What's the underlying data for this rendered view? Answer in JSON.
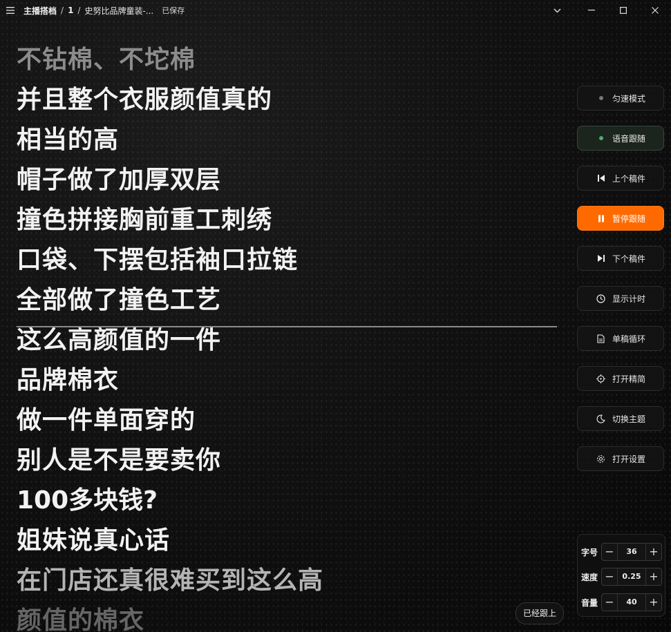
{
  "titlebar": {
    "menu_icon": "hamburger-icon",
    "app_name": "主播搭档",
    "sep1": "/",
    "index": "1",
    "sep2": "/",
    "script_title": "史努比品牌童装-...",
    "status": "已保存",
    "dropdown_icon": "chevron-down-icon",
    "controls": [
      "minimize-icon",
      "maximize-icon",
      "close-icon"
    ]
  },
  "script": {
    "lines": [
      "不钻棉、不坨棉",
      "并且整个衣服颜值真的",
      "相当的高",
      "帽子做了加厚双层",
      "撞色拼接胸前重工刺绣",
      "口袋、下摆包括袖口拉链",
      "全部做了撞色工艺",
      "这么高颜值的一件",
      "品牌棉衣",
      "做一件单面穿的",
      "别人是不是要卖你",
      "100多块钱?",
      "姐妹说真心话",
      "在门店还真很难买到这么高",
      "颜值的棉衣"
    ]
  },
  "caught_up_label": "已经跟上",
  "panel": {
    "buttons": [
      {
        "label": "匀速模式",
        "icon": "dot-icon"
      },
      {
        "label": "语音跟随",
        "icon": "dot-icon"
      },
      {
        "label": "上个稿件",
        "icon": "skip-previous-icon"
      },
      {
        "label": "暂停跟随",
        "icon": "pause-icon"
      },
      {
        "label": "下个稿件",
        "icon": "skip-next-icon"
      },
      {
        "label": "显示计时",
        "icon": "clock-icon"
      },
      {
        "label": "单稿循环",
        "icon": "document-icon"
      },
      {
        "label": "打开精简",
        "icon": "crosshair-icon"
      },
      {
        "label": "切换主题",
        "icon": "moon-icon"
      },
      {
        "label": "打开设置",
        "icon": "gear-icon"
      }
    ],
    "active_color": "#ff6a00",
    "voice_dot_color": "#4caf6a"
  },
  "steppers": [
    {
      "label": "字号",
      "value": "36",
      "minus": "−",
      "plus": "+"
    },
    {
      "label": "速度",
      "value": "0.25",
      "minus": "−",
      "plus": "+"
    },
    {
      "label": "音量",
      "value": "40",
      "minus": "−",
      "plus": "+"
    }
  ]
}
